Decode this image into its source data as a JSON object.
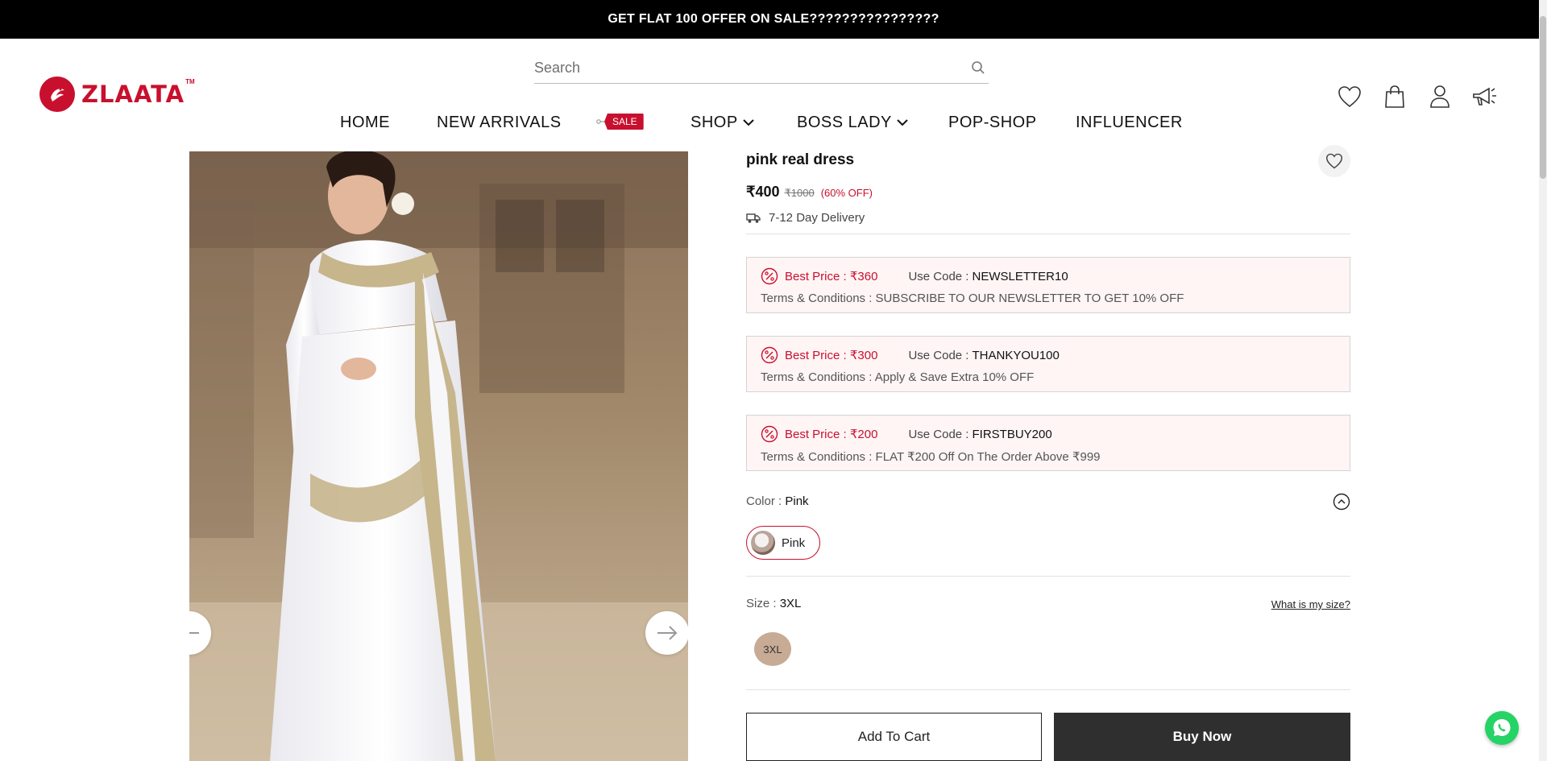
{
  "announcement": "GET FLAT 100 OFFER ON SALE????????????????",
  "logo": {
    "text": "ZLAATA",
    "tm": "TM"
  },
  "search": {
    "placeholder": "Search"
  },
  "nav": {
    "items": [
      "HOME",
      "NEW ARRIVALS",
      "SHOP",
      "BOSS LADY",
      "POP-SHOP",
      "INFLUENCER"
    ],
    "sale_badge": "SALE"
  },
  "header_icons": [
    "heart-icon",
    "shopping-bag-icon",
    "user-icon",
    "megaphone-icon"
  ],
  "product": {
    "title": "pink real dress",
    "price": "₹400",
    "mrp": "₹1000",
    "discount": "(60% OFF)",
    "delivery": "7-12 Day Delivery"
  },
  "coupons": [
    {
      "best_price": "Best Price : ₹360",
      "code_label": "Use Code :",
      "code": "NEWSLETTER10",
      "terms": "Terms & Conditions : SUBSCRIBE TO OUR NEWSLETTER TO GET 10% OFF"
    },
    {
      "best_price": "Best Price : ₹300",
      "code_label": "Use Code :",
      "code": "THANKYOU100",
      "terms": "Terms & Conditions : Apply & Save Extra 10% OFF"
    },
    {
      "best_price": "Best Price : ₹200",
      "code_label": "Use Code :",
      "code": "FIRSTBUY200",
      "terms": "Terms & Conditions : FLAT ₹200 Off On The Order Above ₹999"
    }
  ],
  "color": {
    "label": "Color :",
    "value": "Pink",
    "options": [
      "Pink"
    ]
  },
  "size": {
    "label": "Size :",
    "value": "3XL",
    "options": [
      "3XL"
    ],
    "guide_link": "What is my size?"
  },
  "actions": {
    "add_to_cart": "Add To Cart",
    "buy_now": "Buy Now"
  },
  "colors": {
    "brand": "#c8102e",
    "coupon_bg": "#fff5f5",
    "buy_bg": "#2f2f2f",
    "size_chip": "#c8ab95",
    "whatsapp": "#25d366"
  }
}
